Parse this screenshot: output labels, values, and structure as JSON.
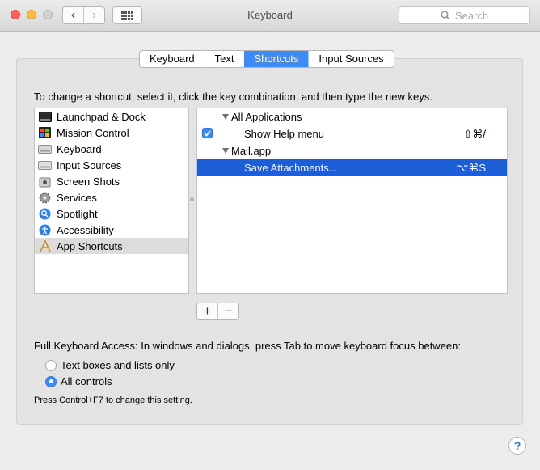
{
  "window": {
    "title": "Keyboard"
  },
  "toolbar": {
    "back_icon": "‹",
    "forward_icon": "›",
    "search_placeholder": "Search"
  },
  "tabs": [
    {
      "label": "Keyboard",
      "active": false
    },
    {
      "label": "Text",
      "active": false
    },
    {
      "label": "Shortcuts",
      "active": true
    },
    {
      "label": "Input Sources",
      "active": false
    }
  ],
  "instructions": "To change a shortcut, select it, click the key combination, and then type the new keys.",
  "categories": [
    {
      "label": "Launchpad & Dock",
      "icon": "launchpad-dock-icon"
    },
    {
      "label": "Mission Control",
      "icon": "mission-control-icon"
    },
    {
      "label": "Keyboard",
      "icon": "keyboard-icon"
    },
    {
      "label": "Input Sources",
      "icon": "input-sources-icon"
    },
    {
      "label": "Screen Shots",
      "icon": "screenshot-icon"
    },
    {
      "label": "Services",
      "icon": "gear-icon"
    },
    {
      "label": "Spotlight",
      "icon": "spotlight-icon"
    },
    {
      "label": "Accessibility",
      "icon": "accessibility-icon"
    },
    {
      "label": "App Shortcuts",
      "icon": "app-shortcuts-icon",
      "selected": true
    }
  ],
  "shortcuts": {
    "group1": {
      "label": "All Applications"
    },
    "item1": {
      "label": "Show Help menu",
      "keys": "⇧⌘/",
      "checked": true
    },
    "group2": {
      "label": "Mail.app"
    },
    "item2": {
      "label": "Save Attachments...",
      "keys": "⌥⌘S",
      "selected": true
    }
  },
  "buttons": {
    "add": "+",
    "remove": "−"
  },
  "full_keyboard_access": {
    "label": "Full Keyboard Access: In windows and dialogs, press Tab to move keyboard focus between:",
    "options": [
      {
        "label": "Text boxes and lists only",
        "selected": false
      },
      {
        "label": "All controls",
        "selected": true
      }
    ],
    "hint": "Press Control+F7 to change this setting."
  },
  "help": {
    "label": "?"
  },
  "colors": {
    "accent": "#3c8bf6",
    "selection": "#1d5dd5"
  }
}
